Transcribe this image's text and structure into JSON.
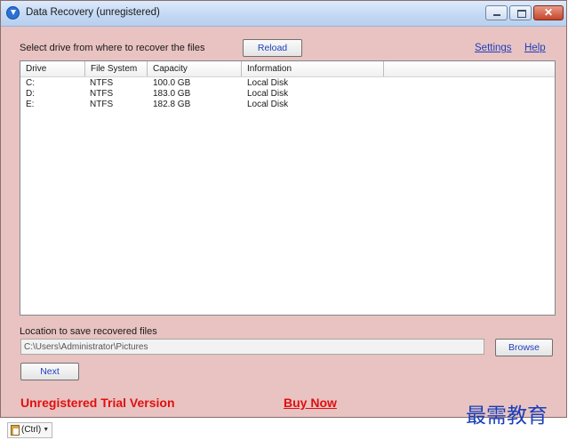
{
  "window": {
    "title": "Data Recovery (unregistered)",
    "controls": {
      "minimize": "—",
      "maximize": "□",
      "close": "✕"
    }
  },
  "header": {
    "prompt": "Select drive from where to recover the files",
    "reload_label": "Reload",
    "settings_label": "Settings",
    "help_label": "Help"
  },
  "drives": {
    "columns": [
      "Drive",
      "File System",
      "Capacity",
      "Information"
    ],
    "rows": [
      {
        "drive": "C:",
        "fs": "NTFS",
        "capacity": "100.0 GB",
        "info": "Local Disk"
      },
      {
        "drive": "D:",
        "fs": "NTFS",
        "capacity": "183.0 GB",
        "info": "Local Disk"
      },
      {
        "drive": "E:",
        "fs": "NTFS",
        "capacity": "182.8 GB",
        "info": "Local Disk"
      }
    ]
  },
  "save": {
    "label": "Location to save recovered files",
    "path": "C:\\Users\\Administrator\\Pictures",
    "browse_label": "Browse"
  },
  "next_label": "Next",
  "footer": {
    "trial_text": "Unregistered Trial Version",
    "buy_label": "Buy Now"
  },
  "watermark": "最需教育",
  "paste_tag": {
    "label": "(Ctrl)",
    "caret": "▼"
  },
  "colors": {
    "window_bg": "#e8c3c1",
    "link": "#1f3fbf",
    "alert_red": "#e01010",
    "watermark": "#1a3fb8"
  }
}
